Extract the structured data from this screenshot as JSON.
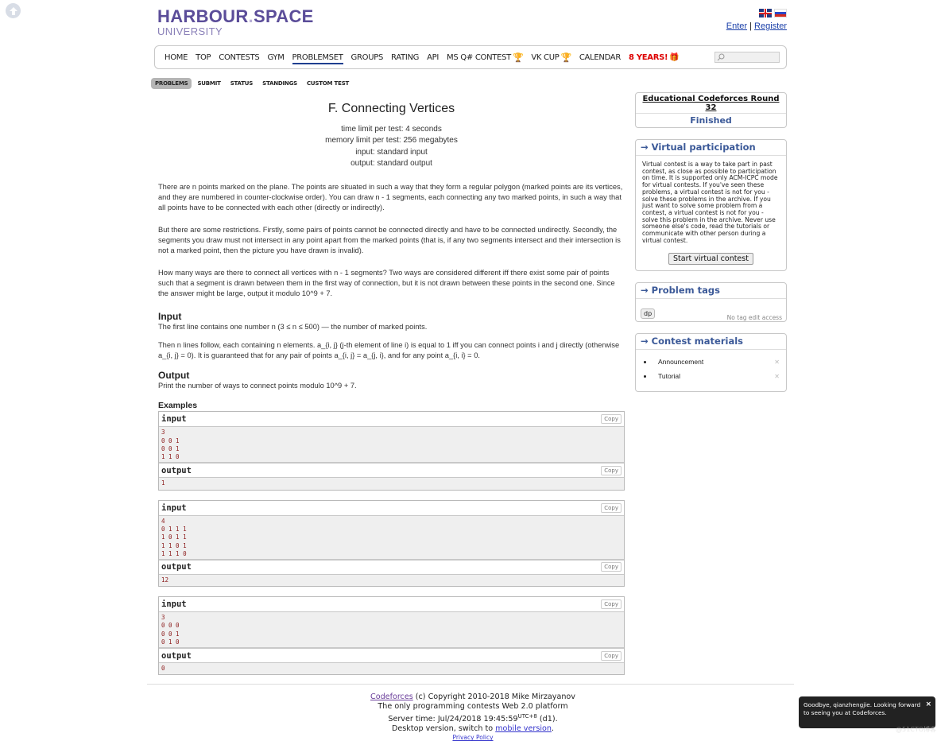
{
  "header": {
    "logo_main": "HARBOUR",
    "logo_dot": ".",
    "logo_second": "SPACE",
    "logo_sub": "UNIVERSITY",
    "auth": {
      "enter": "Enter",
      "separator": "|",
      "register": "Register"
    },
    "languages": [
      "english-flag",
      "russian-flag"
    ]
  },
  "nav": {
    "items": [
      {
        "label": "HOME"
      },
      {
        "label": "TOP"
      },
      {
        "label": "CONTESTS"
      },
      {
        "label": "GYM"
      },
      {
        "label": "PROBLEMSET",
        "active": true
      },
      {
        "label": "GROUPS"
      },
      {
        "label": "RATING"
      },
      {
        "label": "API"
      },
      {
        "label": "MS Q# CONTEST",
        "icon": "trophy-icon"
      },
      {
        "label": "VK CUP",
        "icon": "trophy-icon"
      },
      {
        "label": "CALENDAR"
      },
      {
        "label": "8 YEARS!",
        "icon": "gift-icon",
        "highlight": "#dd0000"
      }
    ],
    "search_placeholder": ""
  },
  "subnav": {
    "tabs": [
      {
        "label": "PROBLEMS",
        "active": true
      },
      {
        "label": "SUBMIT"
      },
      {
        "label": "STATUS"
      },
      {
        "label": "STANDINGS"
      },
      {
        "label": "CUSTOM TEST"
      }
    ]
  },
  "problem": {
    "title": "F. Connecting Vertices",
    "time_limit": "time limit per test: 4 seconds",
    "memory_limit": "memory limit per test: 256 megabytes",
    "input_file": "input: standard input",
    "output_file": "output: standard output",
    "statement": [
      "There are n points marked on the plane. The points are situated in such a way that they form a regular polygon (marked points are its vertices, and they are numbered in counter-clockwise order). You can draw n - 1 segments, each connecting any two marked points, in such a way that all points have to be connected with each other (directly or indirectly).",
      "But there are some restrictions. Firstly, some pairs of points cannot be connected directly and have to be connected undirectly. Secondly, the segments you draw must not intersect in any point apart from the marked points (that is, if any two segments intersect and their intersection is not a marked point, then the picture you have drawn is invalid).",
      "How many ways are there to connect all vertices with n - 1 segments? Two ways are considered different iff there exist some pair of points such that a segment is drawn between them in the first way of connection, but it is not drawn between these points in the second one. Since the answer might be large, output it modulo 10^9 + 7."
    ],
    "input_title": "Input",
    "input_spec": [
      "The first line contains one number n (3 ≤ n ≤ 500) — the number of marked points.",
      "Then n lines follow, each containing n elements. a_{i, j} (j-th element of line i) is equal to 1 iff you can connect points i and j directly (otherwise a_{i, j} = 0). It is guaranteed that for any pair of points a_{i, j} = a_{j, i}, and for any point a_{i, i} = 0."
    ],
    "output_title": "Output",
    "output_spec": "Print the number of ways to connect points modulo 10^9 + 7.",
    "examples_title": "Examples",
    "examples": [
      {
        "input_label": "input",
        "input": "3\n0 0 1\n0 0 1\n1 1 0",
        "output_label": "output",
        "output": "1",
        "copy": "Copy"
      },
      {
        "input_label": "input",
        "input": "4\n0 1 1 1\n1 0 1 1\n1 1 0 1\n1 1 1 0",
        "output_label": "output",
        "output": "12",
        "copy": "Copy"
      },
      {
        "input_label": "input",
        "input": "3\n0 0 0\n0 0 1\n0 1 0",
        "output_label": "output",
        "output": "0",
        "copy": "Copy"
      }
    ]
  },
  "sidebar": {
    "contest": {
      "name": "Educational Codeforces Round 32",
      "phase": "Finished"
    },
    "virtual": {
      "caption": "→ Virtual participation",
      "text": "Virtual contest is a way to take part in past contest, as close as possible to participation on time. It is supported only ACM-ICPC mode for virtual contests. If you've seen these problems, a virtual contest is not for you - solve these problems in the archive. If you just want to solve some problem from a contest, a virtual contest is not for you - solve this problem in the archive. Never use someone else's code, read the tutorials or communicate with other person during a virtual contest.",
      "button": "Start virtual contest"
    },
    "tags": {
      "caption": "→ Problem tags",
      "items": [
        "dp"
      ],
      "note": "No tag edit access"
    },
    "materials": {
      "caption": "→ Contest materials",
      "items": [
        "Announcement",
        "Tutorial"
      ]
    }
  },
  "footer": {
    "site": "Codeforces",
    "copyright": " (c) Copyright 2010-2018 Mike Mirzayanov",
    "tagline": "The only programming contests Web 2.0 platform",
    "server_time_prefix": "Server time: Jul/24/2018 19:45:59",
    "server_tz": "UTC+8",
    "server_suffix": " (d1).",
    "desktop_prefix": "Desktop version, switch to ",
    "mobile_link": "mobile version",
    "desktop_suffix": ".",
    "privacy": "Privacy Policy"
  },
  "toast": {
    "message": "Goodbye, qianzhengjie. Looking forward to seeing you at Codeforces.",
    "close": "×"
  },
  "watermark": "@51CTO博客"
}
